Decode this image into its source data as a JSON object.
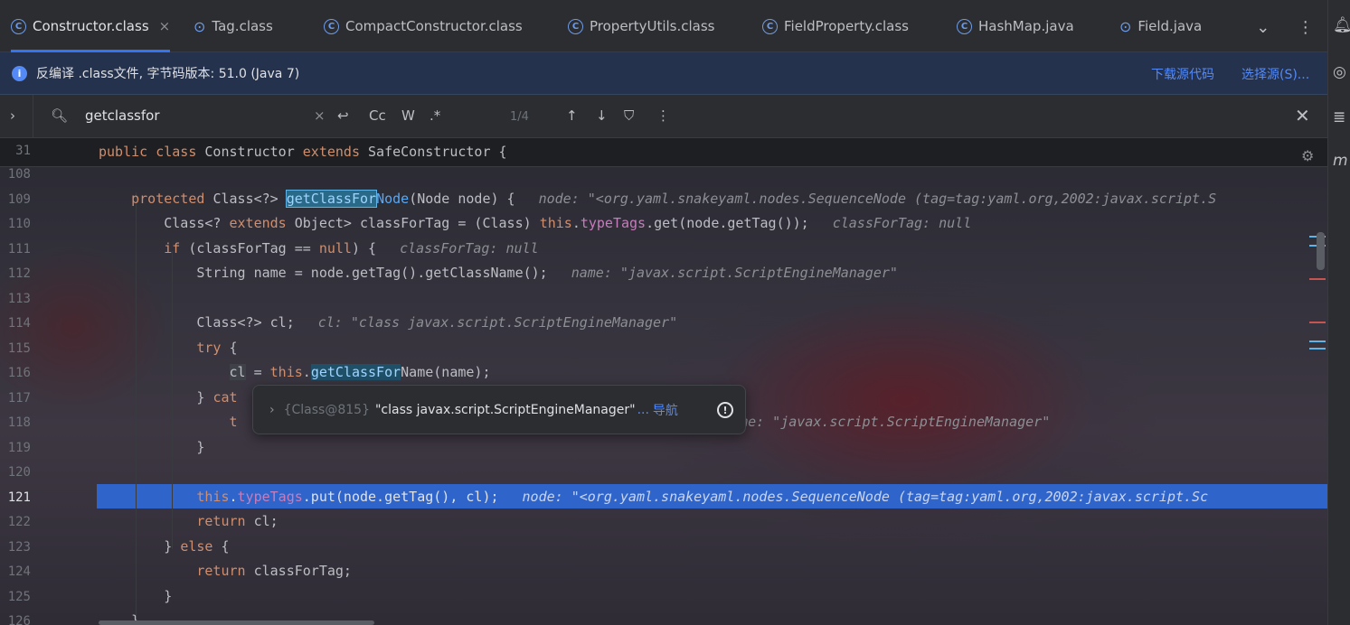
{
  "tabs": [
    {
      "label": "Constructor.class",
      "icon": "class-icon",
      "active": true
    },
    {
      "label": "Tag.class",
      "icon": "tag-class-icon"
    },
    {
      "label": "CompactConstructor.class",
      "icon": "class-icon"
    },
    {
      "label": "PropertyUtils.class",
      "icon": "class-icon"
    },
    {
      "label": "FieldProperty.class",
      "icon": "class-icon"
    },
    {
      "label": "HashMap.java",
      "icon": "class-icon"
    },
    {
      "label": "Field.java",
      "icon": "tag-class-icon"
    }
  ],
  "banner": {
    "text": "反编译 .class文件, 字节码版本: 51.0 (Java 7)",
    "download_link": "下载源代码",
    "choose_source_link": "选择源(S)..."
  },
  "find": {
    "query": "getclassfor",
    "case_label": "Cc",
    "word_label": "W",
    "regex_label": ".*",
    "match_count": "1/4"
  },
  "sticky": {
    "line_no": "31",
    "code": "public class Constructor extends SafeConstructor {"
  },
  "lines": [
    {
      "no": "108"
    },
    {
      "no": "109",
      "hint": "node: \"<org.yaml.snakeyaml.nodes.SequenceNode (tag=tag:yaml.org,2002:javax.script.S"
    },
    {
      "no": "110",
      "hint": "classForTag: null"
    },
    {
      "no": "111",
      "hint": "classForTag: null"
    },
    {
      "no": "112",
      "hint": "name: \"javax.script.ScriptEngineManager\""
    },
    {
      "no": "113"
    },
    {
      "no": "114",
      "hint": "cl: \"class javax.script.ScriptEngineManager\""
    },
    {
      "no": "115"
    },
    {
      "no": "116"
    },
    {
      "no": "117"
    },
    {
      "no": "118",
      "hint": "name: \"javax.script.ScriptEngineManager\""
    },
    {
      "no": "119"
    },
    {
      "no": "120"
    },
    {
      "no": "121",
      "hint": "node: \"<org.yaml.snakeyaml.nodes.SequenceNode (tag=tag:yaml.org,2002:javax.script.Sc"
    },
    {
      "no": "122"
    },
    {
      "no": "123"
    },
    {
      "no": "124"
    },
    {
      "no": "125"
    },
    {
      "no": "126"
    }
  ],
  "popup": {
    "id": "{Class@815}",
    "value": "\"class javax.script.ScriptEngineManager\"",
    "ellipsis": "...",
    "nav_label": "导航"
  },
  "colors": {
    "accent": "#3574f0",
    "current_line": "#2f65ca",
    "keyword": "#cf8e6d",
    "method": "#56a8f5",
    "field": "#c77dbb"
  }
}
